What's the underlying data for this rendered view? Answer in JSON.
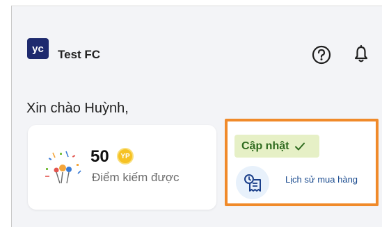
{
  "header": {
    "logo_text": "yc",
    "app_name": "Test FC",
    "help_icon": "question-circle-icon",
    "notification_icon": "bell-icon"
  },
  "greeting": "Xin chào Huỳnh,",
  "points_card": {
    "value": "50",
    "coin_label": "YP",
    "label": "Điểm kiếm được",
    "icon": "confetti-icon"
  },
  "history_card": {
    "badge": "Cập nhật",
    "badge_icon": "check-icon",
    "icon": "receipt-icon",
    "label": "Lịch sử mua hàng",
    "highlight_color": "#f08a2a"
  },
  "colors": {
    "brand": "#1e2a6e",
    "badge_bg": "#e6f0c6",
    "badge_text": "#2f6b1f",
    "link": "#1a4b8f",
    "coin": "#f6c223"
  }
}
